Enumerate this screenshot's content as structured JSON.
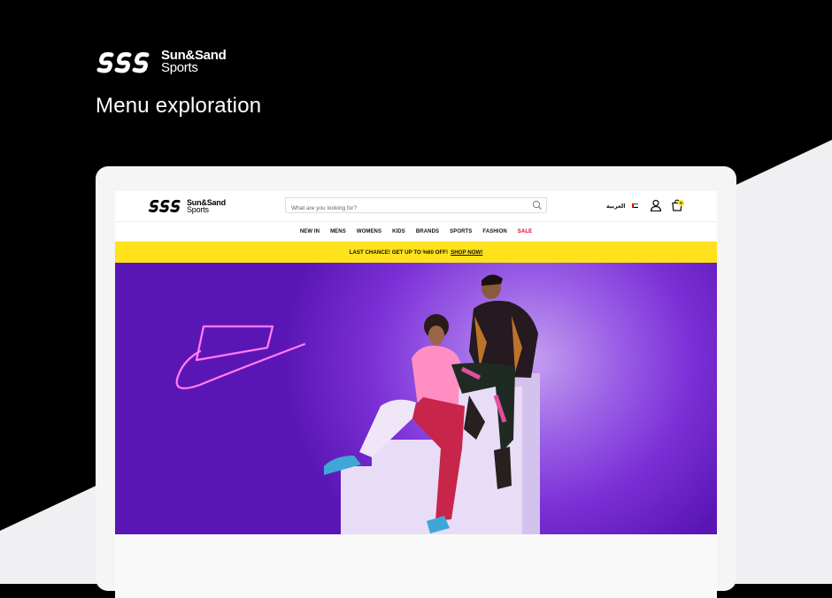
{
  "brand": {
    "name_line1": "Sun&Sand",
    "name_line2": "Sports"
  },
  "heading": "Menu exploration",
  "site": {
    "logo": {
      "name_line1": "Sun&Sand",
      "name_line2": "Sports"
    },
    "search": {
      "placeholder": "What are you looking for?"
    },
    "language": "العربية",
    "cart_count": "0",
    "nav": [
      "NEW IN",
      "MENS",
      "WOMENS",
      "KIDS",
      "BRANDS",
      "SPORTS",
      "FASHION",
      "SALE"
    ],
    "promo": {
      "text": "LAST CHANCE! GET UP TO %60 OFF!",
      "link": "SHOP NOW!"
    }
  },
  "colors": {
    "accent": "#ffe21c",
    "sale": "#e4002b",
    "hero": "#7b2fd6"
  }
}
